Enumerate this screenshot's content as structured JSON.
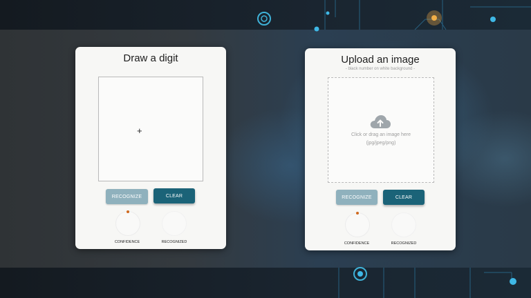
{
  "draw": {
    "title": "Draw a digit",
    "recognize_label": "Recognize",
    "clear_label": "Clear",
    "confidence_label": "Confidence",
    "recognized_label": "Recognized"
  },
  "upload": {
    "title": "Upload an image",
    "subtitle": "- black number on white background -",
    "drop_text": "Click or drag an image here",
    "drop_formats": "(jpg/jpeg/png)",
    "recognize_label": "Recognize",
    "clear_label": "Clear",
    "confidence_label": "Confidence",
    "recognized_label": "Recognized"
  },
  "colors": {
    "accent": "#1b6378",
    "disabled_button": "#8fb1bd",
    "confidence_marker": "#d06a1f"
  },
  "icons": [
    "crosshair-cursor-icon",
    "cloud-upload-icon"
  ]
}
